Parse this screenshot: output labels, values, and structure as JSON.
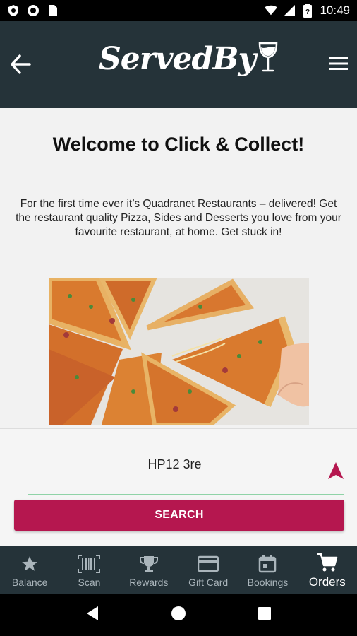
{
  "status_bar": {
    "time": "10:49",
    "left_icons": [
      "shield-icon",
      "record-icon",
      "sim-card-icon"
    ],
    "right_icons": [
      "wifi-icon",
      "signal-icon",
      "battery-icon"
    ]
  },
  "header": {
    "logo_text": "ServedBy",
    "back_icon": "arrow-left-icon",
    "menu_icon": "hamburger-menu-icon",
    "background_color": "#253339"
  },
  "main": {
    "title": "Welcome to Click & Collect!",
    "description": "For the first time ever it’s Quadranet Restaurants – delivered! Get the restaurant quality Pizza, Sides and Desserts you love from your favourite restaurant, at home. Get stuck in!",
    "image_subject": "pizza-slices"
  },
  "search": {
    "postcode_value": "HP12 3re",
    "button_label": "SEARCH",
    "button_color": "#b5174f",
    "locate_icon": "navigation-arrow-icon"
  },
  "bottom_nav": {
    "items": [
      {
        "label": "Balance",
        "icon": "star-icon"
      },
      {
        "label": "Scan",
        "icon": "barcode-icon"
      },
      {
        "label": "Rewards",
        "icon": "trophy-icon"
      },
      {
        "label": "Gift Card",
        "icon": "credit-card-icon"
      },
      {
        "label": "Bookings",
        "icon": "calendar-icon"
      },
      {
        "label": "Orders",
        "icon": "cart-icon",
        "active": true
      }
    ]
  },
  "android_nav": {
    "icons": [
      "back-triangle-icon",
      "home-circle-icon",
      "recents-square-icon"
    ]
  }
}
